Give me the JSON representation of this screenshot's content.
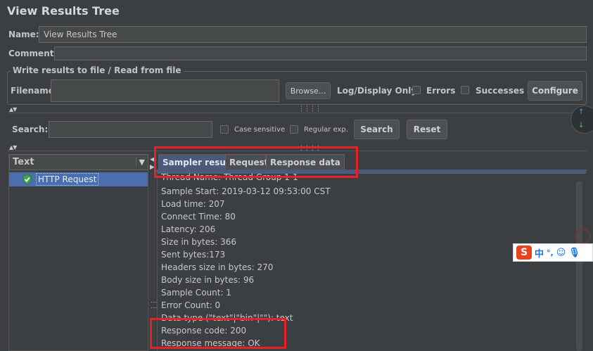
{
  "window": {
    "title": "View Results Tree"
  },
  "name_row": {
    "label": "Name:",
    "value": "View Results Tree"
  },
  "comments_row": {
    "label": "Comments:",
    "value": ""
  },
  "file_section": {
    "legend": "Write results to file / Read from file",
    "filename_label": "Filename",
    "filename_value": "",
    "browse_label": "Browse...",
    "log_display_label": "Log/Display Only:",
    "errors_label": "Errors",
    "successes_label": "Successes",
    "configure_label": "Configure"
  },
  "search": {
    "label": "Search:",
    "value": "",
    "case_sensitive_label": "Case sensitive",
    "regex_label": "Regular exp.",
    "search_button": "Search",
    "reset_button": "Reset"
  },
  "tree": {
    "renderer_label": "Text",
    "items": [
      {
        "label": "HTTP Request",
        "status": "success"
      }
    ]
  },
  "tabs": [
    {
      "label": "Sampler result",
      "active": true
    },
    {
      "label": "Request",
      "active": false
    },
    {
      "label": "Response data",
      "active": false
    }
  ],
  "sampler_result_lines": [
    "Thread Name: Thread Group 1-1",
    "Sample Start: 2019-03-12 09:53:00 CST",
    "Load time: 207",
    "Connect Time: 80",
    "Latency: 206",
    "Size in bytes: 366",
    "Sent bytes:173",
    "Headers size in bytes: 270",
    "Body size in bytes: 96",
    "Sample Count: 1",
    "Error Count: 0",
    "Data type (\"text\"|\"bin\"|\"\"): text",
    "Response code: 200",
    "Response message: OK"
  ],
  "ime_toolbar": {
    "logo": "S",
    "lang": "中",
    "punct": "°,"
  },
  "colors": {
    "background": "#3c3f41",
    "active_tab": "#4a5a78",
    "selection": "#4b6eaf",
    "highlight_box": "#e8202a",
    "success_icon": "#3aa655"
  }
}
